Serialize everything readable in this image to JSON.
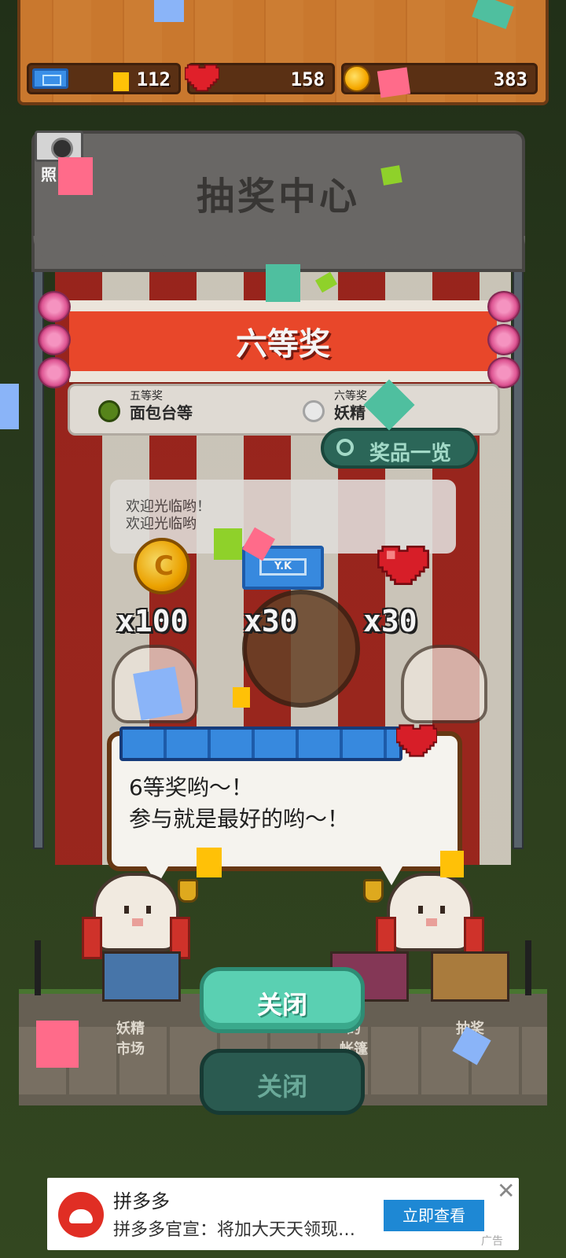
{
  "top_bar": {
    "tickets": "112",
    "hearts": "158",
    "coins": "383"
  },
  "camera": {
    "label": "照"
  },
  "booth": {
    "title": "抽奖中心",
    "banner": "六等奖",
    "prize_left_rank": "五等奖",
    "prize_left_name": "面包台等",
    "prize_right_rank": "六等奖",
    "prize_right_name": "妖精",
    "prize_list_button": "奖品一览",
    "welcome_1": "欢迎光临哟！",
    "welcome_2": "欢迎光临哟"
  },
  "rewards": [
    {
      "icon": "coin-icon",
      "amount": "x100"
    },
    {
      "icon": "ticket-icon",
      "amount": "x30",
      "ticket_text": "Y.K"
    },
    {
      "icon": "heart-icon",
      "amount": "x30"
    }
  ],
  "dialog": {
    "line1": "6等奖哟～！",
    "line2": "参与就是最好的哟～！"
  },
  "town": {
    "shop_left": "妖精\n市场",
    "shop_mid": "",
    "shop_right": "的\n帐篷",
    "shop_far": "抽奖\n中心"
  },
  "buttons": {
    "close": "关闭",
    "close_dim": "关闭"
  },
  "ad": {
    "title": "拼多多",
    "description": "拼多多官宣：将加大天天领现…",
    "cta": "立即查看",
    "close": "✕",
    "tag": "广告"
  },
  "colors": {
    "banner_red": "#f24a2c",
    "button_teal": "#5ad0b2",
    "ad_blue": "#1e88d4"
  }
}
